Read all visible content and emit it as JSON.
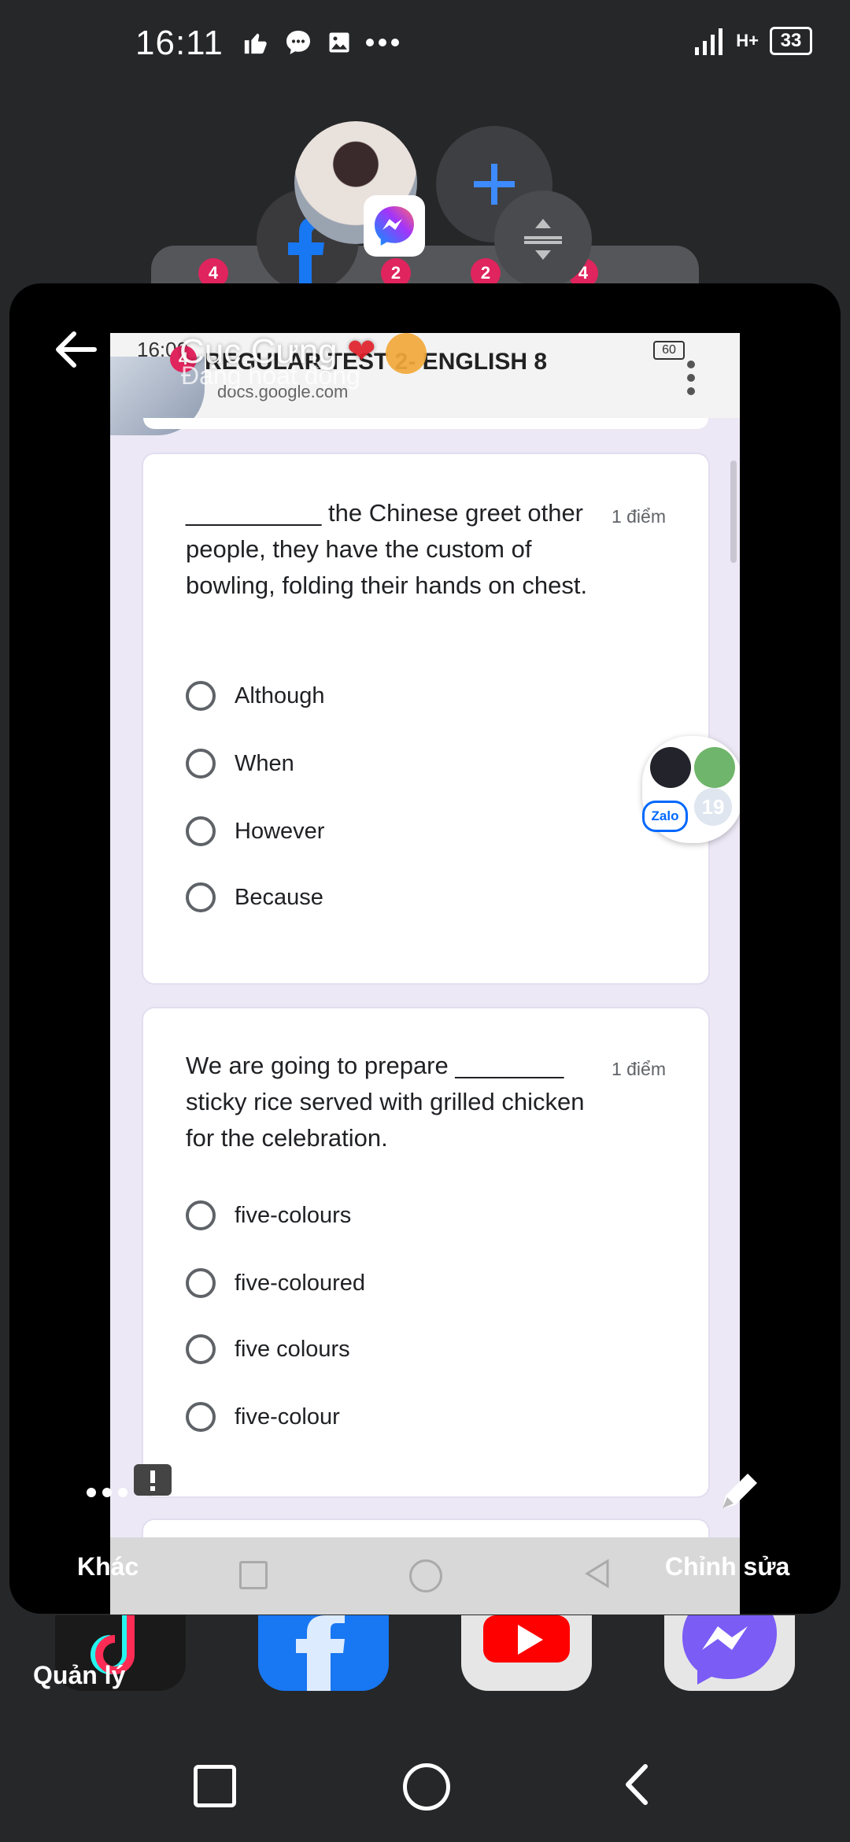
{
  "status_bar": {
    "time": "16:11",
    "notification_icons": [
      "thumbs-up-icon",
      "chat-bubble-icon",
      "image-icon",
      "more-dots-icon"
    ],
    "network": "H+",
    "battery": "33"
  },
  "chat_heads": {
    "badges": [
      "4",
      "2",
      "2",
      "4"
    ]
  },
  "recent_card": {
    "chat_name": "Cục Cưng",
    "chat_status": "Đang hoạt động",
    "inner_status_time": "16:00",
    "inner_badge": "4",
    "inner_battery": "60",
    "page_title": "REGULAR TEST 2- ENGLISH 8",
    "page_url": "docs.google.com",
    "questions": [
      {
        "text": "__________ the Chinese greet other people, they have the custom of bowling, folding their hands on chest.",
        "points": "1 điểm",
        "options": [
          "Although",
          "When",
          "However",
          "Because"
        ]
      },
      {
        "text": "We are going to prepare ________ sticky rice served with grilled chicken for the celebration.",
        "points": "1 điểm",
        "options": [
          "five-colours",
          "five-coloured",
          "five colours",
          "five-colour"
        ]
      }
    ],
    "zalo_label": "Zalo",
    "zalo_count": "19"
  },
  "actions": {
    "more_label": "Khác",
    "edit_label": "Chỉnh sửa",
    "manage_label": "Quản lý"
  },
  "colors": {
    "accent_blue": "#1a73e8",
    "badge_red": "#e0245e",
    "form_background": "#ece8f5"
  }
}
